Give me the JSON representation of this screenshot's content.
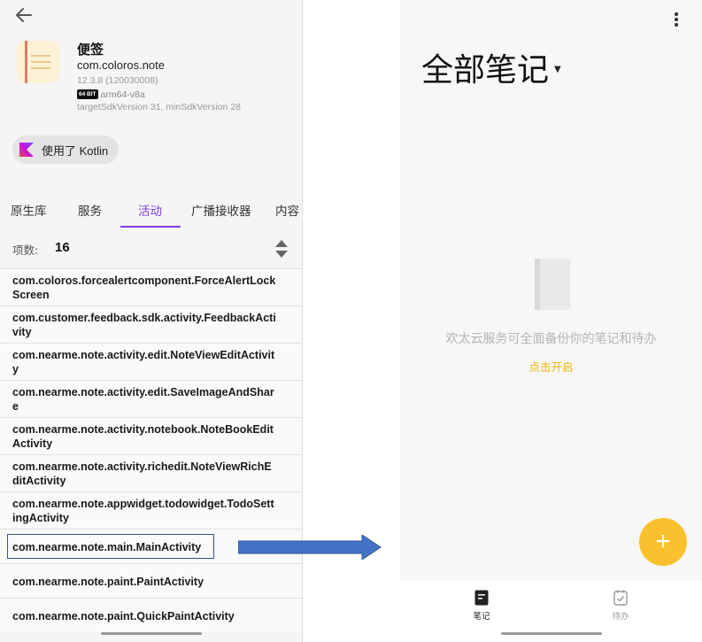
{
  "app": {
    "name": "便签",
    "package": "com.coloros.note",
    "version": "12.3.8 (120030008)",
    "bit_badge": "64 BIT",
    "abi": "arm64-v8a",
    "sdk": "targetSdkVersion 31, minSdkVersion 28",
    "kotlin_chip": "使用了 Kotlin"
  },
  "tabs": [
    {
      "label": "原生库"
    },
    {
      "label": "服务"
    },
    {
      "label": "活动",
      "active": true
    },
    {
      "label": "广播接收器"
    },
    {
      "label": "内容"
    }
  ],
  "count": {
    "label": "项数:",
    "value": "16"
  },
  "activities": [
    "com.coloros.forcealertcomponent.ForceAlertLockScreen",
    "com.customer.feedback.sdk.activity.FeedbackActivity",
    "com.nearme.note.activity.edit.NoteViewEditActivity",
    "com.nearme.note.activity.edit.SaveImageAndShare",
    "com.nearme.note.activity.notebook.NoteBookEditActivity",
    "com.nearme.note.activity.richedit.NoteViewRichEditActivity",
    "com.nearme.note.appwidget.todowidget.TodoSettingActivity",
    "com.nearme.note.main.MainActivity",
    "com.nearme.note.paint.PaintActivity",
    "com.nearme.note.paint.QuickPaintActivity"
  ],
  "notes_screen": {
    "title": "全部笔记",
    "empty_message": "欢太云服务可全面备份你的笔记和待办",
    "enable_link": "点击开启",
    "fab_symbol": "+",
    "nav": [
      {
        "label": "笔记",
        "icon": "note-icon",
        "active": true
      },
      {
        "label": "待办",
        "icon": "todo-icon",
        "active": false
      }
    ]
  },
  "colors": {
    "accent_purple": "#7b3fe4",
    "highlight_blue": "#2f5597",
    "arrow_blue": "#4472c4",
    "fab_yellow": "#fbc02d",
    "link_yellow": "#f2b705"
  }
}
